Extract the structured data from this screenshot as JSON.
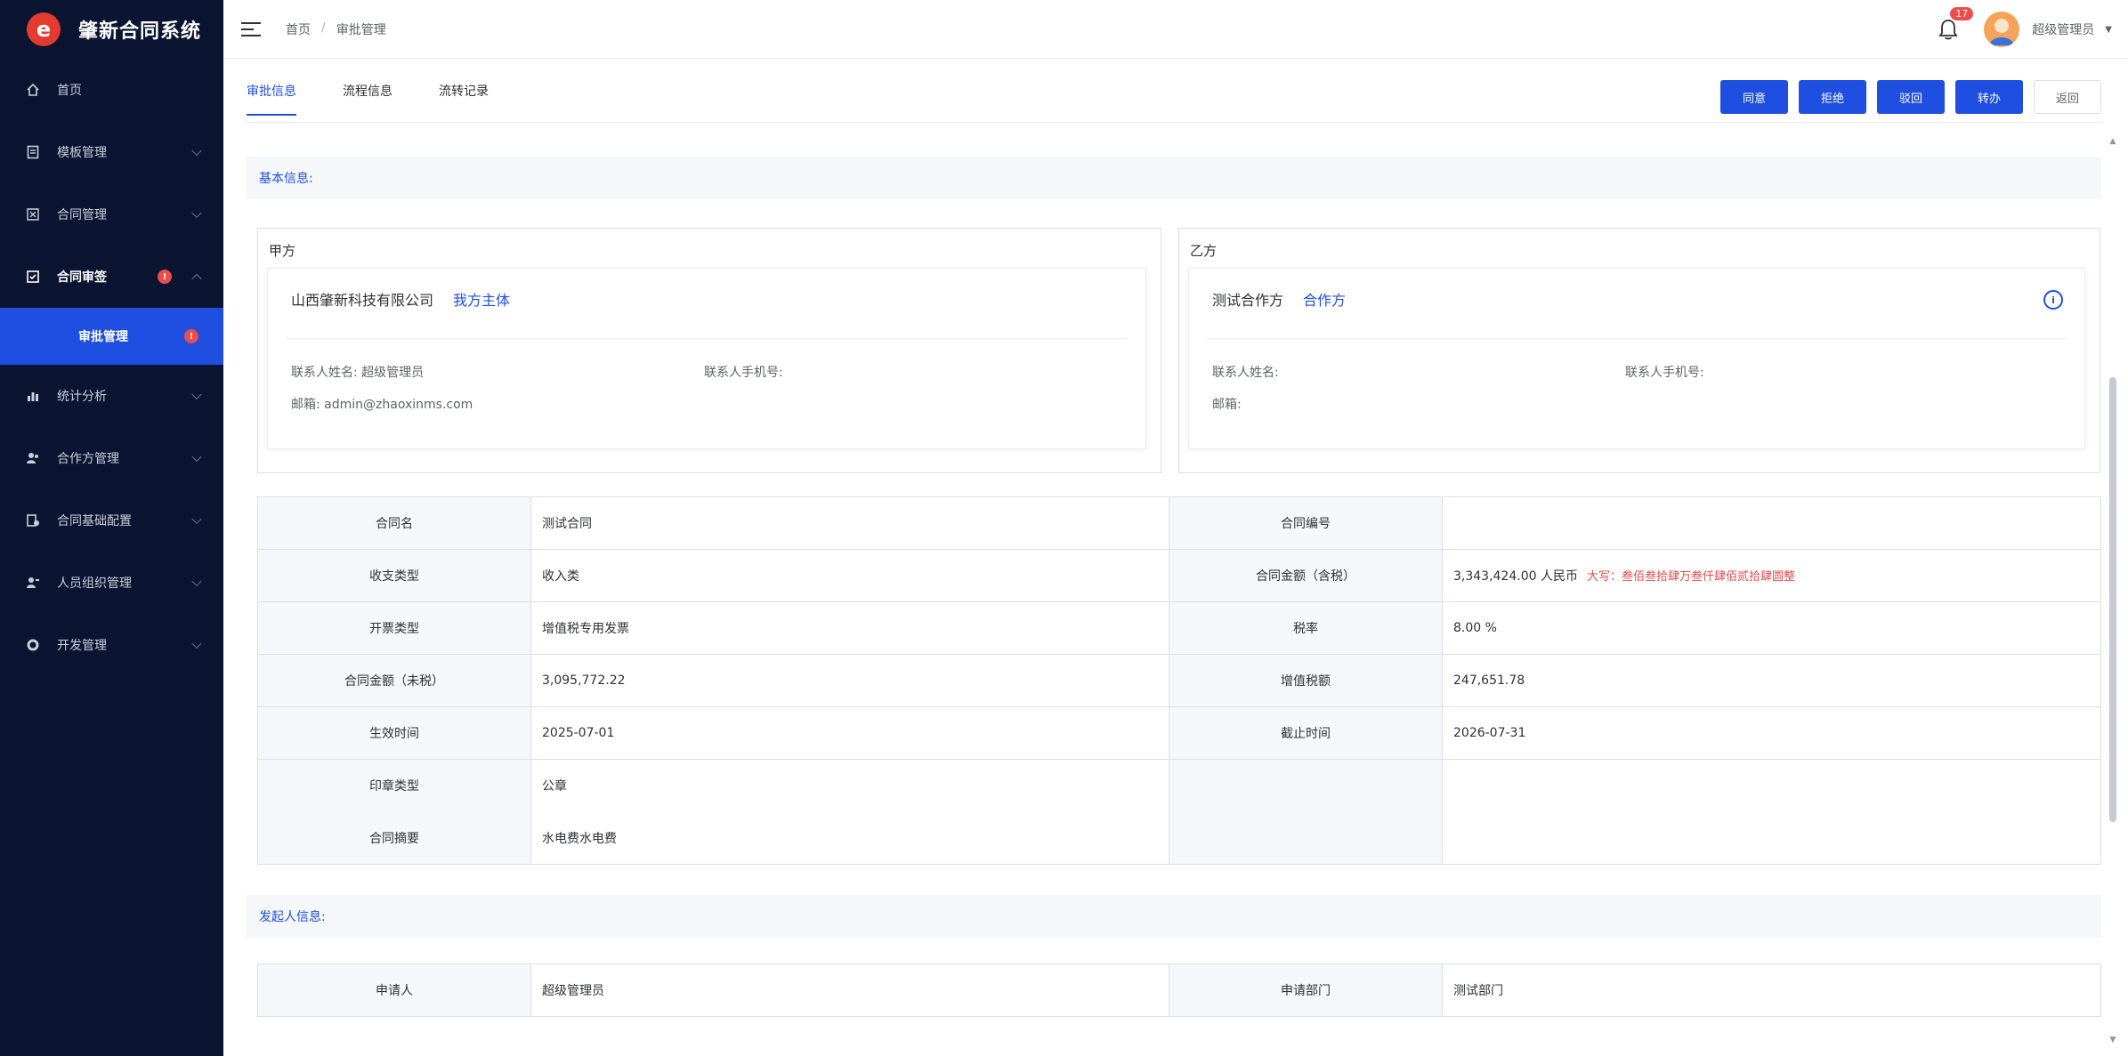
{
  "app": {
    "title": "肇新合同系统",
    "logo_letter": "e"
  },
  "sidebar": {
    "items": [
      {
        "label": "首页",
        "icon": "home-icon",
        "expandable": false
      },
      {
        "label": "模板管理",
        "icon": "template-icon",
        "expandable": true
      },
      {
        "label": "合同管理",
        "icon": "contract-icon",
        "expandable": true
      },
      {
        "label": "合同审签",
        "icon": "sign-icon",
        "expandable": true,
        "badge": "!"
      },
      {
        "label": "审批管理",
        "icon": "approval-icon",
        "active": true,
        "badge": "!"
      },
      {
        "label": "统计分析",
        "icon": "chart-icon",
        "expandable": true
      },
      {
        "label": "合作方管理",
        "icon": "partner-icon",
        "expandable": true
      },
      {
        "label": "合同基础配置",
        "icon": "config-icon",
        "expandable": true
      },
      {
        "label": "人员组织管理",
        "icon": "org-icon",
        "expandable": true
      },
      {
        "label": "开发管理",
        "icon": "dev-icon",
        "expandable": true
      }
    ]
  },
  "header": {
    "breadcrumb": [
      "首页",
      "审批管理"
    ],
    "notification_count": "17",
    "username": "超级管理员"
  },
  "tabs": [
    {
      "label": "审批信息",
      "active": true
    },
    {
      "label": "流程信息",
      "active": false
    },
    {
      "label": "流转记录",
      "active": false
    }
  ],
  "actions": {
    "agree": "同意",
    "reject": "拒绝",
    "back": "驳回",
    "transfer": "转办",
    "return": "返回"
  },
  "basic_info": {
    "title": "基本信息:",
    "party_a": {
      "title": "甲方",
      "company": "山西肇新科技有限公司",
      "tag": "我方主体",
      "contact_name_label": "联系人姓名:",
      "contact_name": "超级管理员",
      "contact_phone_label": "联系人手机号:",
      "contact_phone": "",
      "email_label": "邮箱:",
      "email": "admin@zhaoxinms.com"
    },
    "party_b": {
      "title": "乙方",
      "company": "测试合作方",
      "tag": "合作方",
      "contact_name_label": "联系人姓名:",
      "contact_name": "",
      "contact_phone_label": "联系人手机号:",
      "contact_phone": "",
      "email_label": "邮箱:",
      "email": ""
    }
  },
  "detail_table": {
    "rows": [
      {
        "l1": "合同名",
        "v1": "测试合同",
        "l2": "合同编号",
        "v2": ""
      },
      {
        "l1": "收支类型",
        "v1": "收入类",
        "l2": "合同金额（含税）",
        "v2": "3,343,424.00 人民币",
        "v2_note": "大写：叁佰叁拾肆万叁仟肆佰贰拾肆圆整"
      },
      {
        "l1": "开票类型",
        "v1": "增值税专用发票",
        "l2": "税率",
        "v2": "8.00 %"
      },
      {
        "l1": "合同金额（未税）",
        "v1": "3,095,772.22",
        "l2": "增值税额",
        "v2": "247,651.78"
      },
      {
        "l1": "生效时间",
        "v1": "2025-07-01",
        "l2": "截止时间",
        "v2": "2026-07-31"
      }
    ],
    "seal_label": "印章类型",
    "seal_value": "公章",
    "summary_label": "合同摘要",
    "summary_value": "水电费水电费"
  },
  "initiator": {
    "title": "发起人信息:",
    "applicant_label": "申请人",
    "applicant": "超级管理员",
    "dept_label": "申请部门",
    "dept": "测试部门"
  }
}
